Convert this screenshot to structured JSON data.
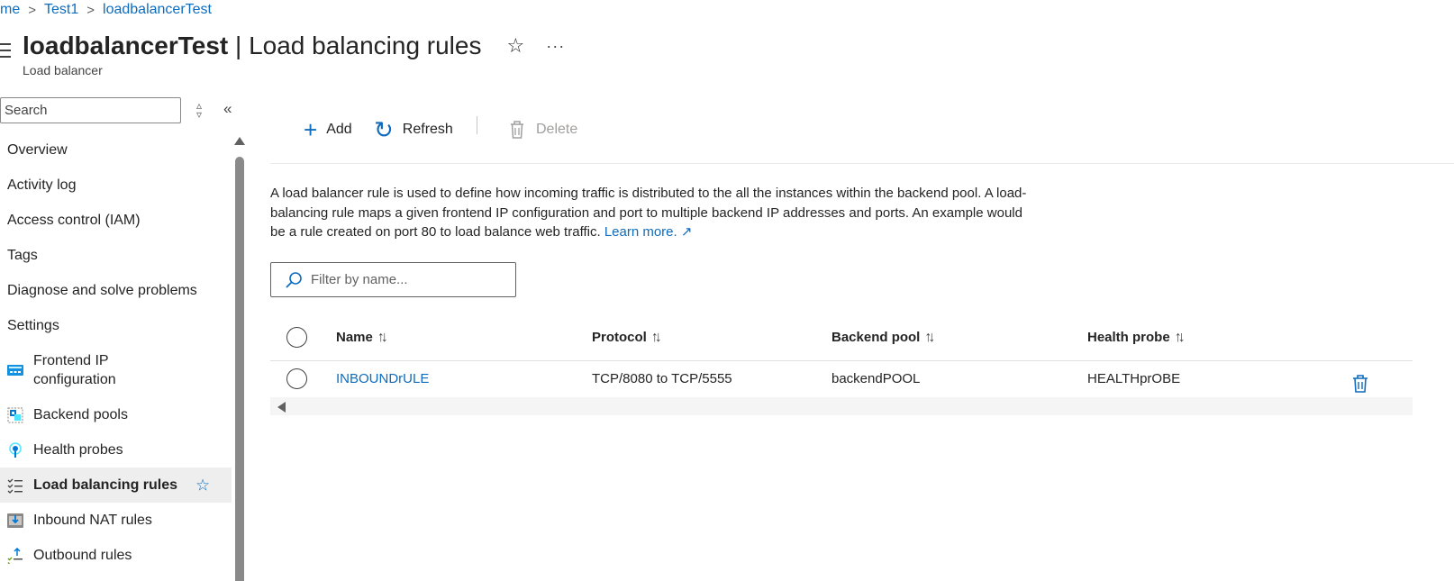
{
  "breadcrumb": {
    "items": [
      "me",
      "Test1",
      "loadbalancerTest"
    ],
    "separator": ">"
  },
  "header": {
    "resource_name": "loadbalancerTest",
    "title_rest": " | Load balancing rules",
    "subtitle": "Load balancer",
    "favorite_icon": "star-outline-icon",
    "more_label": "···"
  },
  "sidebar": {
    "search_placeholder": "Search",
    "sort_glyph": "◇",
    "collapse_glyph": "«",
    "items": [
      {
        "label": "Overview"
      },
      {
        "label": "Activity log"
      },
      {
        "label": "Access control (IAM)"
      },
      {
        "label": "Tags"
      },
      {
        "label": "Diagnose and solve problems"
      },
      {
        "label": "Settings"
      },
      {
        "label": "Frontend IP configuration",
        "icon": "frontend-ip-icon"
      },
      {
        "label": "Backend pools",
        "icon": "backend-pools-icon"
      },
      {
        "label": "Health probes",
        "icon": "health-probe-icon"
      },
      {
        "label": "Load balancing rules",
        "icon": "rules-list-icon",
        "selected": true,
        "favorite_glyph": "☆"
      },
      {
        "label": "Inbound NAT rules",
        "icon": "inbound-nat-icon"
      },
      {
        "label": "Outbound rules",
        "icon": "outbound-rules-icon"
      }
    ]
  },
  "toolbar": {
    "add_label": "Add",
    "add_glyph": "+",
    "refresh_label": "Refresh",
    "refresh_glyph": "↻",
    "delete_label": "Delete",
    "separator": "|"
  },
  "description": {
    "text": "A load balancer rule is used to define how incoming traffic is distributed to the all the instances within the backend pool. A load-balancing rule maps a given frontend IP configuration and port to multiple backend IP addresses and ports. An example would be a rule created on port 80 to load balance web traffic.",
    "link_label": "Learn more.",
    "link_glyph": "↗"
  },
  "filter": {
    "placeholder": "Filter by name..."
  },
  "table": {
    "sort_glyph": "↑↓",
    "columns": [
      "Name",
      "Protocol",
      "Backend pool",
      "Health probe"
    ],
    "rows": [
      {
        "name": "INBOUNDrULE",
        "protocol": "TCP/8080 to TCP/5555",
        "backend_pool": "backendPOOL",
        "health_probe": "HEALTHprOBE"
      }
    ]
  },
  "colors": {
    "accent": "#0f6cbd",
    "text": "#242424",
    "selected_bg": "#eeeeee",
    "disabled": "#a19f9d"
  }
}
